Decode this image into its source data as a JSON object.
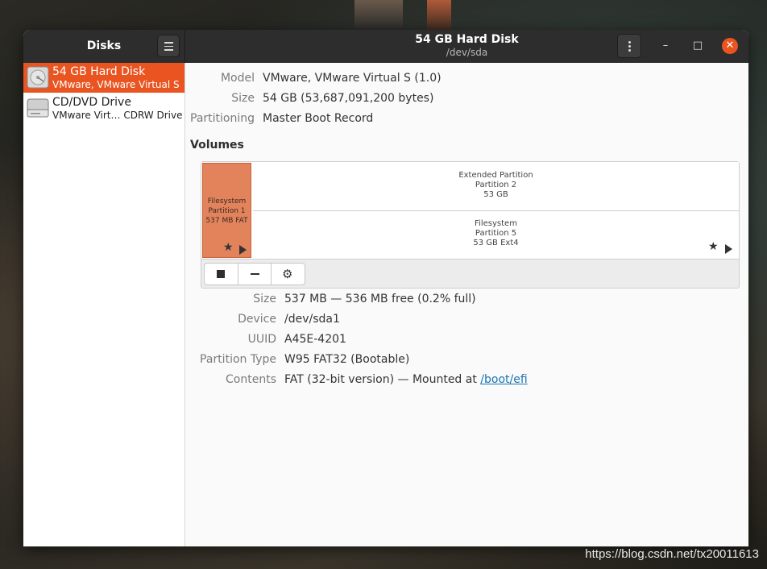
{
  "sidebar": {
    "title": "Disks",
    "drives": [
      {
        "name": "54 GB Hard Disk",
        "sub": "VMware, VMware Virtual S",
        "icon": "hard-disk-icon",
        "selected": true
      },
      {
        "name": "CD/DVD Drive",
        "sub": "VMware Virt… CDRW Drive",
        "icon": "optical-drive-icon",
        "selected": false
      }
    ]
  },
  "header": {
    "title": "54 GB Hard Disk",
    "subtitle": "/dev/sda",
    "minimize": "–",
    "maximize": "□",
    "close": "✕"
  },
  "disk": {
    "model_label": "Model",
    "model": "VMware, VMware Virtual S (1.0)",
    "size_label": "Size",
    "size": "54 GB (53,687,091,200 bytes)",
    "partitioning_label": "Partitioning",
    "partitioning": "Master Boot Record"
  },
  "volumes": {
    "title": "Volumes",
    "partition1": {
      "line1": "Filesystem",
      "line2": "Partition 1",
      "line3": "537 MB FAT"
    },
    "extended": {
      "line1": "Extended Partition",
      "line2": "Partition 2",
      "line3": "53 GB"
    },
    "partition5": {
      "line1": "Filesystem",
      "line2": "Partition 5",
      "line3": "53 GB Ext4"
    }
  },
  "partition": {
    "size_label": "Size",
    "size": "537 MB — 536 MB free (0.2% full)",
    "device_label": "Device",
    "device": "/dev/sda1",
    "uuid_label": "UUID",
    "uuid": "A45E-4201",
    "type_label": "Partition Type",
    "type": "W95 FAT32 (Bootable)",
    "contents_label": "Contents",
    "contents_prefix": "FAT (32-bit version) — Mounted at ",
    "mount_link": "/boot/efi"
  },
  "colors": {
    "accent": "#e95420",
    "partition_selected": "#e2835c",
    "link": "#1a73b3"
  },
  "watermark": "https://blog.csdn.net/tx20011613"
}
